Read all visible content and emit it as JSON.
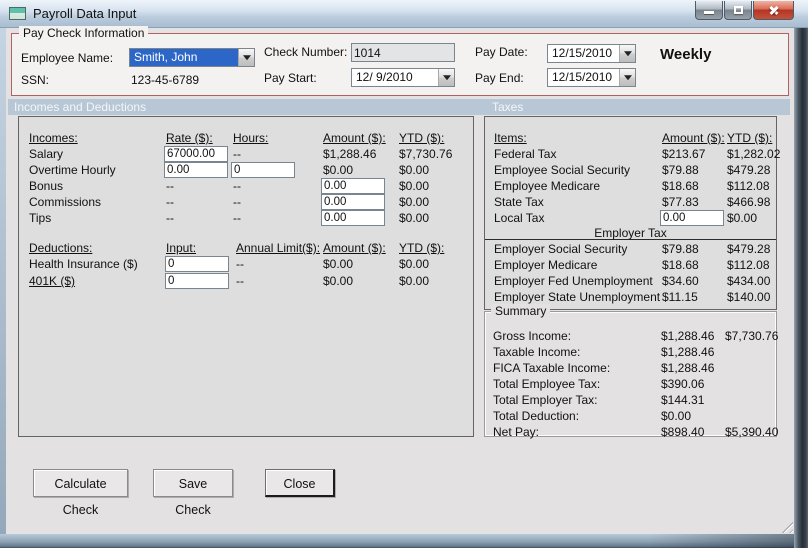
{
  "colors": {
    "groupbox_border_red": "#b06161",
    "section_band_blue": "#b7c7d5",
    "selection_blue": "#2c67c8",
    "close_button_red": "#b33523",
    "titlebar_blue": "#bccddd",
    "client_gray": "#e3e1e1"
  },
  "icons": {
    "form": "form-icon",
    "minimize": "minimize-icon",
    "maximize": "maximize-icon",
    "close": "close-icon",
    "dropdown": "chevron-down-icon",
    "resize": "resize-grip-icon"
  },
  "window": {
    "title": "Payroll Data Input"
  },
  "paycheck": {
    "group_label": "Pay Check Information",
    "employee_name": {
      "label": "Employee Name:",
      "value": "Smith, John"
    },
    "ssn": {
      "label": "SSN:",
      "value": "123-45-6789"
    },
    "check_number": {
      "label": "Check Number:",
      "value": "1014"
    },
    "pay_start": {
      "label": "Pay Start:",
      "value": "12/ 9/2010"
    },
    "pay_date": {
      "label": "Pay Date:",
      "value": "12/15/2010"
    },
    "pay_end": {
      "label": "Pay End:",
      "value": "12/15/2010"
    },
    "frequency": "Weekly"
  },
  "sections": {
    "left": "Incomes and Deductions",
    "right": "Taxes"
  },
  "incomes": {
    "headers": {
      "item": "Incomes:",
      "rate": "Rate ($):",
      "hours": "Hours:",
      "amount": "Amount ($):",
      "ytd": "YTD ($):"
    },
    "salary": {
      "label": "Salary",
      "rate": "67000.00",
      "hours": "--",
      "amount": "$1,288.46",
      "ytd": "$7,730.76"
    },
    "overtime": {
      "label": "Overtime Hourly",
      "rate": "0.00",
      "hours": "0",
      "amount": "$0.00",
      "ytd": "$0.00"
    },
    "bonus": {
      "label": "Bonus",
      "rate": "--",
      "hours": "--",
      "amount": "0.00",
      "ytd": "$0.00"
    },
    "commissions": {
      "label": "Commissions",
      "rate": "--",
      "hours": "--",
      "amount": "0.00",
      "ytd": "$0.00"
    },
    "tips": {
      "label": "Tips",
      "rate": "--",
      "hours": "--",
      "amount": "0.00",
      "ytd": "$0.00"
    }
  },
  "deductions": {
    "headers": {
      "item": "Deductions:",
      "input": "Input:",
      "limit": "Annual Limit($):",
      "amount": "Amount ($):",
      "ytd": "YTD ($):"
    },
    "health": {
      "label": "Health Insurance  ($)",
      "input": "0",
      "limit": "--",
      "amount": "$0.00",
      "ytd": "$0.00"
    },
    "k401": {
      "label": "401K  ($)",
      "input": "0",
      "limit": "--",
      "amount": "$0.00",
      "ytd": "$0.00"
    }
  },
  "taxes": {
    "headers": {
      "item": "Items:",
      "amount": "Amount ($):",
      "ytd": "YTD ($):"
    },
    "rows": [
      {
        "label": "Federal Tax",
        "amount": "$213.67",
        "ytd": "$1,282.02"
      },
      {
        "label": "Employee Social Security",
        "amount": "$79.88",
        "ytd": "$479.28"
      },
      {
        "label": "Employee Medicare",
        "amount": "$18.68",
        "ytd": "$112.08"
      },
      {
        "label": "State Tax",
        "amount": "$77.83",
        "ytd": "$466.98"
      }
    ],
    "local_tax": {
      "label": "Local Tax",
      "amount": "0.00",
      "ytd": "$0.00"
    },
    "employer_header": "Employer Tax",
    "employer_rows": [
      {
        "label": "Employer Social Security",
        "amount": "$79.88",
        "ytd": "$479.28"
      },
      {
        "label": "Employer Medicare",
        "amount": "$18.68",
        "ytd": "$112.08"
      },
      {
        "label": "Employer Fed Unemployment",
        "amount": "$34.60",
        "ytd": "$434.00"
      },
      {
        "label": "Employer State Unemployment",
        "amount": "$11.15",
        "ytd": "$140.00"
      }
    ]
  },
  "summary": {
    "group_label": "Summary",
    "rows": [
      {
        "label": "Gross Income:",
        "amount": "$1,288.46",
        "ytd": "$7,730.76"
      },
      {
        "label": "Taxable Income:",
        "amount": "$1,288.46",
        "ytd": ""
      },
      {
        "label": "FICA Taxable Income:",
        "amount": "$1,288.46",
        "ytd": ""
      },
      {
        "label": "Total Employee Tax:",
        "amount": "$390.06",
        "ytd": ""
      },
      {
        "label": "Total Employer Tax:",
        "amount": "$144.31",
        "ytd": ""
      },
      {
        "label": "Total Deduction:",
        "amount": "$0.00",
        "ytd": ""
      },
      {
        "label": "Net Pay:",
        "amount": "$898.40",
        "ytd": "$5,390.40"
      }
    ]
  },
  "buttons": {
    "calculate": "Calculate Check",
    "save": "Save Check",
    "close": "Close"
  }
}
